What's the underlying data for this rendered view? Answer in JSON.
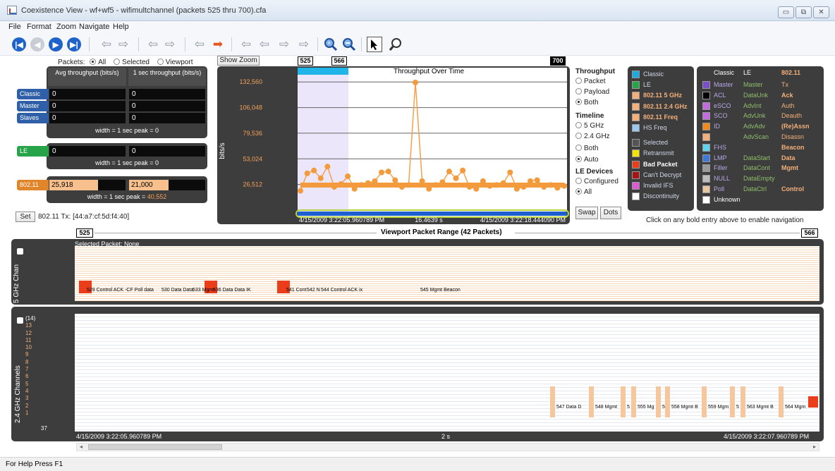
{
  "window": {
    "title": "Coexistence View - wf+wf5 - wifimultchannel (packets 525 thru 700).cfa",
    "minimize": "▭",
    "restore": "⧉",
    "close": "✕"
  },
  "menu": [
    "File",
    "Format",
    "Zoom",
    "Navigate",
    "Help"
  ],
  "toolbar": {
    "icons": [
      "first-icon",
      "prev-icon",
      "next-icon",
      "last-icon",
      "arrow-left-icon",
      "arrow-right-icon",
      "arrow-left-icon",
      "arrow-right-icon",
      "arrow-left-icon",
      "arrow-right-red-icon",
      "arrow-left-icon",
      "arrow-left-icon",
      "arrow-right-icon",
      "arrow-right-icon",
      "zoom-in-icon",
      "zoom-out-icon",
      "pointer-icon",
      "magnifier-icon"
    ]
  },
  "packets_filter": {
    "label": "Packets:",
    "options": [
      "All",
      "Selected",
      "Viewport"
    ],
    "selected": "All"
  },
  "stats": {
    "col_avg": "Avg throughput (bits/s)",
    "col_peak": "1 sec throughput (bits/s)",
    "rows": [
      {
        "label": "Classic",
        "avg": "0",
        "peak": "0"
      },
      {
        "label": "Master",
        "avg": "0",
        "peak": "0"
      },
      {
        "label": "Slaves",
        "avg": "0",
        "peak": "0"
      }
    ],
    "classic_width": "width = 1 sec peak = 0",
    "le": {
      "label": "LE",
      "avg": "0",
      "peak": "0",
      "width": "width = 1 sec peak = 0"
    },
    "wifi": {
      "label": "802.11",
      "avg": "25,918",
      "peak": "21,000",
      "width_prefix": "width = 1 sec peak = ",
      "width_value": "40,552",
      "avg_fill": 0.64,
      "peak_fill": 0.52
    }
  },
  "set_button": "Set",
  "set_text": "802.11 Tx: [44:a7:cf:5d:f4:40]",
  "show_zoom": "Show Zoom",
  "range_tags": {
    "start": "525",
    "end": "566",
    "total": "700"
  },
  "chart_data": {
    "type": "line",
    "title": "Throughput Over Time",
    "ylabel": "bits/s",
    "yticks": [
      "132,560",
      "106,048",
      "79,536",
      "53,024",
      "26,512"
    ],
    "ylim": [
      0,
      140000
    ],
    "x_start": "4/15/2009 3:22:05.960789 PM",
    "x_mid": "16.4639 s",
    "x_end": "4/15/2009 3:22:18.444090 PM",
    "series": [
      {
        "values": [
          20000,
          38000,
          41000,
          33000,
          45000,
          24000,
          27000,
          35000,
          22000,
          26000,
          28000,
          30000,
          39000,
          40000,
          31000,
          24000,
          26000,
          132000,
          30000,
          22000,
          26000,
          29000,
          40000,
          33000,
          41000,
          24000,
          22000,
          30000,
          25000,
          26000,
          28000,
          39000,
          22000,
          24000,
          30000,
          31000,
          24000,
          26000,
          23000,
          25000
        ]
      },
      {
        "values": [
          25918,
          25918,
          25918,
          25918,
          25918,
          25918,
          25918,
          25918,
          25918,
          25918,
          25918,
          25918,
          25918,
          25918,
          25918,
          25918,
          25918,
          25918,
          25918,
          25918,
          25918,
          25918,
          25918,
          25918,
          25918,
          25918,
          25918,
          25918,
          25918,
          25918,
          25918,
          25918,
          25918,
          25918,
          25918,
          25918,
          25918,
          25918,
          25918,
          25918
        ]
      }
    ]
  },
  "throughput_opts": {
    "title": "Throughput",
    "options": [
      "Packet",
      "Payload",
      "Both"
    ],
    "selected": "Both"
  },
  "timeline_opts": {
    "title": "Timeline",
    "options": [
      "5 GHz",
      "2.4 GHz",
      "Both",
      "Auto"
    ],
    "selected": "Auto"
  },
  "le_opts": {
    "title": "LE Devices",
    "options": [
      "Configured",
      "All"
    ],
    "selected": "All"
  },
  "swap_btn": "Swap",
  "dots_btn": "Dots",
  "legend_left": [
    {
      "label": "Classic",
      "color": "#1ea9e0"
    },
    {
      "label": "LE",
      "color": "#27a34a"
    },
    {
      "label": "802.11 5 GHz",
      "color": "#f3b07a"
    },
    {
      "label": "802.11 2.4 GHz",
      "color": "#f3b07a"
    },
    {
      "label": "802.11 Freq",
      "color": "#f3b07a"
    },
    {
      "label": "HS Freq",
      "color": "#9cc9f0"
    },
    {
      "label": "Selected",
      "color": "#555555"
    },
    {
      "label": "Retransmit",
      "color": "#f2e600"
    },
    {
      "label": "Bad Packet",
      "color": "#ea3d1a"
    },
    {
      "label": "Can't Decrypt",
      "color": "#a81414"
    },
    {
      "label": "Invalid IFS",
      "color": "#e05ad6"
    },
    {
      "label": "Discontinuity",
      "color": "#ffffff"
    }
  ],
  "legend_right": {
    "headers": [
      "Classic",
      "LE",
      "802.11"
    ],
    "rows": [
      {
        "color": "#7a4fc9",
        "c": "Master",
        "l": "Master",
        "w": "Tx"
      },
      {
        "color": "#000000",
        "c": "ACL",
        "l": "DataUnk",
        "w": "Ack"
      },
      {
        "color": "#c36ae0",
        "c": "eSCO",
        "l": "AdvInt",
        "w": "Auth"
      },
      {
        "color": "#c36ae0",
        "c": "SCO",
        "l": "AdvUnk",
        "w": "Deauth"
      },
      {
        "color": "#f08a1c",
        "c": "ID",
        "l": "AdvAdv",
        "w": "(Re)Assn"
      },
      {
        "color": "#f3b07a",
        "c": "",
        "l": "AdvScan",
        "w": "Disassn"
      },
      {
        "color": "#5fd2ee",
        "c": "FHS",
        "l": "",
        "w": "Beacon"
      },
      {
        "color": "#3e78d8",
        "c": "LMP",
        "l": "DataStart",
        "w": "Data"
      },
      {
        "color": "#9a9a9a",
        "c": "Filler",
        "l": "DataCont",
        "w": "Mgmt"
      },
      {
        "color": "#bcbcbc",
        "c": "NULL",
        "l": "DataEmpty",
        "w": ""
      },
      {
        "color": "#e8c8a0",
        "c": "Poll",
        "l": "DataCtrl",
        "w": "Control"
      },
      {
        "color": "#ffffff",
        "c": "Unknown",
        "l": "",
        "w": ""
      }
    ]
  },
  "nav_hint": "Click on any bold entry above to enable navigation",
  "viewport_range": {
    "start": "525",
    "end": "566",
    "label": "Viewport Packet Range (42 Packets)"
  },
  "lane5": {
    "title": "5 GHz Chan",
    "selected": "Selected Packet: None",
    "packets": [
      "529 Control ACK -CF Poll data",
      "530 Data Data",
      "533 Mgmt",
      "536 Data Data IK",
      "541 Cont",
      "542 N",
      "544 Control ACK ix",
      "545 Mgmt Beacon"
    ]
  },
  "lane24": {
    "title": "2.4 GHz Channels",
    "channels": [
      "(14)",
      "13",
      "12",
      "11",
      "10",
      "9",
      "8",
      "7",
      "6",
      "5",
      "4",
      "3",
      "2",
      "1"
    ],
    "bottom_num": "37",
    "packets": [
      "547 Data D",
      "548 Mgmt",
      "5",
      "555 Mg",
      "557",
      "558 Mgmt B",
      "559 Mgm",
      "5",
      "563 Mgmt B",
      "564 Mgm"
    ]
  },
  "time_axis": {
    "start": "4/15/2009 3:22:05.960789 PM",
    "mid": "2 s",
    "end": "4/15/2009 3:22:07.960789 PM"
  },
  "status": "For Help Press F1"
}
